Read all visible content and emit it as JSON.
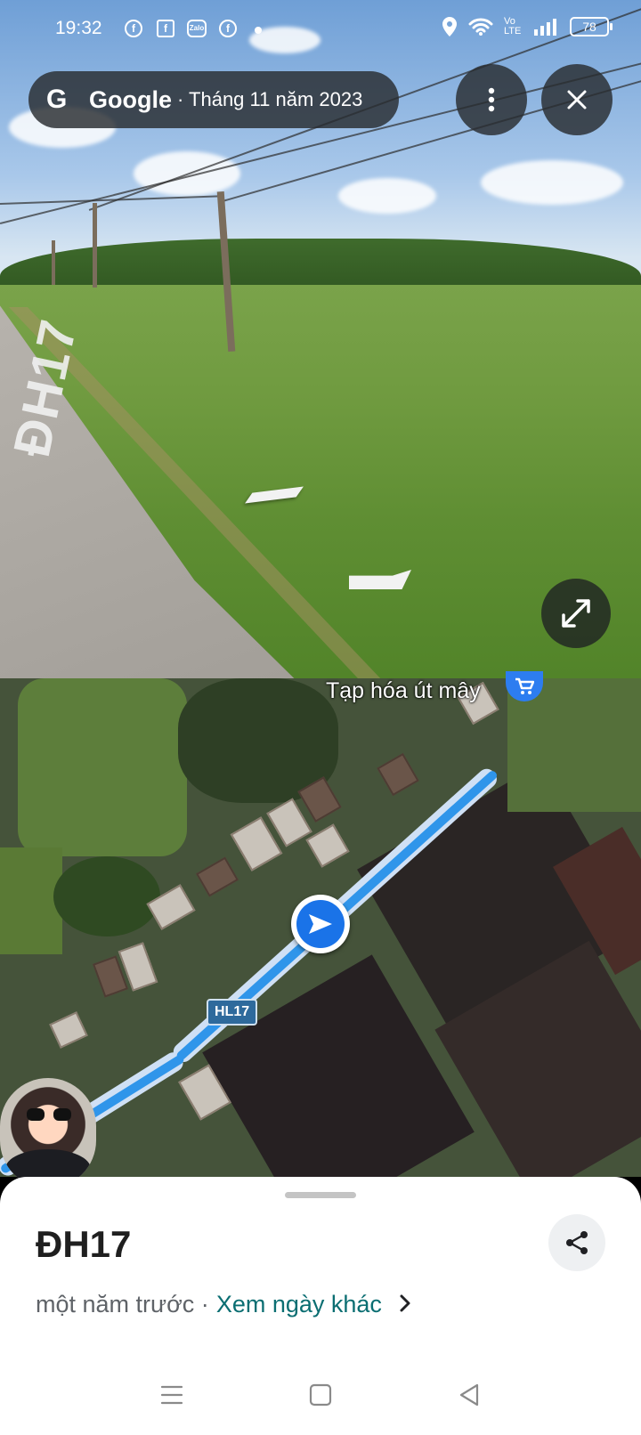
{
  "status_bar": {
    "time": "19:32",
    "app_icons": [
      "facebook-icon",
      "facebook-square-icon",
      "zalo-icon",
      "facebook-icon"
    ],
    "zalo_text": "Zalo",
    "battery": "78",
    "volte": "Vo LTE"
  },
  "street_view": {
    "brand": "Google",
    "date": "· Tháng 11 năm 2023",
    "road_marking": "ĐH17"
  },
  "map": {
    "place_name": "Tạp hóa út mây",
    "road_label": "HL17"
  },
  "place_sheet": {
    "title": "ĐH17",
    "time_ago": "một năm trước ·",
    "other_dates_link": "Xem ngày khác"
  },
  "colors": {
    "route": "#2f95ea",
    "link": "#0b6e72",
    "pin": "#1a73e8"
  }
}
